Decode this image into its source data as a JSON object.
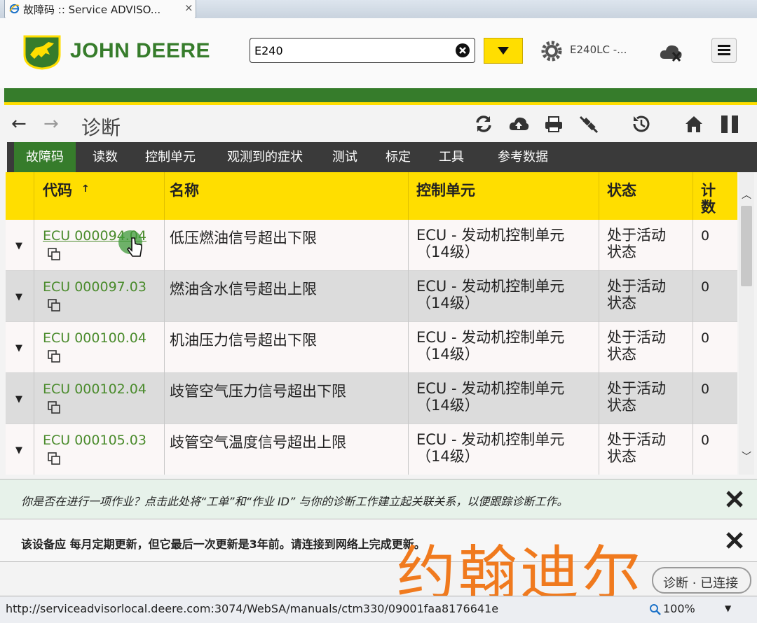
{
  "browser": {
    "tab_title": "故障码 :: Service ADVISO...",
    "tab_close": "×",
    "status_url": "http://serviceadvisorlocal.deere.com:3074/WebSA/manuals/ctm330/09001faa8176641e",
    "zoom": "100%"
  },
  "header": {
    "brand": "JOHN DEERE",
    "search_value": "E240",
    "machine_label": "E240LC -..."
  },
  "toolbar": {
    "back": "←",
    "forward": "→",
    "title": "诊断"
  },
  "nav": {
    "items": [
      {
        "label": "故障码",
        "active": true
      },
      {
        "label": "读数"
      },
      {
        "label": "控制单元"
      },
      {
        "label": "观测到的症状"
      },
      {
        "label": "测试"
      },
      {
        "label": "标定"
      },
      {
        "label": "工具"
      },
      {
        "label": "参考数据"
      }
    ]
  },
  "table": {
    "headers": {
      "code": "代码",
      "sort_indicator": "↑",
      "name": "名称",
      "control_unit": "控制单元",
      "status": "状态",
      "count_line1": "计",
      "count_line2": "数"
    },
    "rows": [
      {
        "code": "ECU 000094.04",
        "name": "低压燃油信号超出下限",
        "unit_line1": "ECU - 发动机控制单元",
        "unit_line2": "（14级）",
        "status_line1": "处于活动",
        "status_line2": "状态",
        "count": "0"
      },
      {
        "code": "ECU 000097.03",
        "name": "燃油含水信号超出上限",
        "unit_line1": "ECU - 发动机控制单元",
        "unit_line2": "（14级）",
        "status_line1": "处于活动",
        "status_line2": "状态",
        "count": "0"
      },
      {
        "code": "ECU 000100.04",
        "name": "机油压力信号超出下限",
        "unit_line1": "ECU - 发动机控制单元",
        "unit_line2": "（14级）",
        "status_line1": "处于活动",
        "status_line2": "状态",
        "count": "0"
      },
      {
        "code": "ECU 000102.04",
        "name": "歧管空气压力信号超出下限",
        "unit_line1": "ECU - 发动机控制单元",
        "unit_line2": "（14级）",
        "status_line1": "处于活动",
        "status_line2": "状态",
        "count": "0"
      },
      {
        "code": "ECU 000105.03",
        "name": "歧管空气温度信号超出上限",
        "unit_line1": "ECU - 发动机控制单元",
        "unit_line2": "（14级）",
        "status_line1": "处于活动",
        "status_line2": "状态",
        "count": "0"
      }
    ]
  },
  "messages": {
    "work_order": "你是否在进行一项作业？点击此处将“工单”和“作业 ID” 与你的诊断工作建立起关联关系，以便跟踪诊断工作。",
    "update_notice": "该设备应 每月定期更新，但它最后一次更新是3年前。请连接到网络上完成更新。"
  },
  "connection": {
    "label": "诊断 · 已连接"
  },
  "overlay": {
    "text": "约翰迪尔"
  },
  "colors": {
    "brand_green": "#367c2b",
    "brand_yellow": "#ffde00",
    "nav_bg": "#3a3a3a",
    "overlay_orange": "#f07a1e"
  },
  "icons": [
    "ie-icon",
    "clear-icon",
    "dropdown-icon",
    "gear-icon",
    "cloud-offline-icon",
    "menu-icon",
    "refresh-icon",
    "cloud-upload-icon",
    "printer-icon",
    "disconnect-icon",
    "history-icon",
    "home-icon",
    "pause-icon",
    "copy-icon",
    "close-icon"
  ]
}
